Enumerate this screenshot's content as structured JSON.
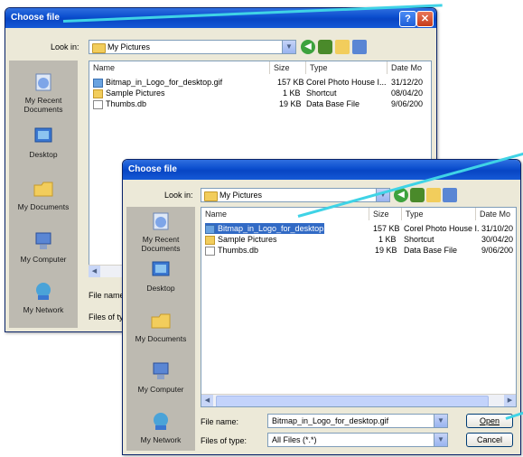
{
  "back_dialog": {
    "title": "Choose file",
    "help": "?",
    "close": "✕",
    "look_in_label": "Look in:",
    "look_in_value": "My Pictures",
    "columns": [
      "Name",
      "Size",
      "Type",
      "Date Mo"
    ],
    "files": [
      {
        "name": "Bitmap_in_Logo_for_desktop.gif",
        "size": "157 KB",
        "type": "Corel Photo House I...",
        "date": "31/12/20"
      },
      {
        "name": "Sample Pictures",
        "size": "1 KB",
        "type": "Shortcut",
        "date": "08/04/20"
      },
      {
        "name": "Thumbs.db",
        "size": "19 KB",
        "type": "Data Base File",
        "date": "9/06/200"
      }
    ],
    "places": [
      "My Recent Documents",
      "Desktop",
      "My Documents",
      "My Computer",
      "My Network"
    ],
    "file_name_label": "File name",
    "files_of_type_label": "Files of typ"
  },
  "front_dialog": {
    "title": "Choose file",
    "look_in_label": "Look in:",
    "look_in_value": "My Pictures",
    "columns": [
      "Name",
      "Size",
      "Type",
      "Date Mo"
    ],
    "files": [
      {
        "name": "Bitmap_in_Logo_for_desktop.gif",
        "size": "157 KB",
        "type": "Corel Photo House I...",
        "date": "31/10/20"
      },
      {
        "name": "Sample Pictures",
        "size": "1 KB",
        "type": "Shortcut",
        "date": "30/04/20"
      },
      {
        "name": "Thumbs.db",
        "size": "19 KB",
        "type": "Data Base File",
        "date": "9/06/200"
      }
    ],
    "places": [
      "My Recent Documents",
      "Desktop",
      "My Documents",
      "My Computer",
      "My Network"
    ],
    "file_name_label": "File name:",
    "file_name_value": "Bitmap_in_Logo_for_desktop.gif",
    "files_of_type_label": "Files of type:",
    "files_of_type_value": "All Files (*.*)",
    "open_label": "Open",
    "cancel_label": "Cancel"
  },
  "colors": {
    "title_bar": "#0a4dcd",
    "selection": "#316ac5",
    "callout": "#3fd3e6",
    "dialog_bg": "#ece9d8",
    "places_bg": "#bdbab1"
  }
}
